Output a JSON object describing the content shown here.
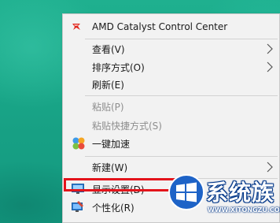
{
  "context_menu": {
    "items": [
      {
        "label": "AMD Catalyst Control Center",
        "icon": "amd-icon",
        "disabled": false,
        "submenu": false
      },
      {
        "label": "查看(V)",
        "icon": null,
        "disabled": false,
        "submenu": true
      },
      {
        "label": "排序方式(O)",
        "icon": null,
        "disabled": false,
        "submenu": true
      },
      {
        "label": "刷新(E)",
        "icon": null,
        "disabled": false,
        "submenu": false
      },
      {
        "label": "粘贴(P)",
        "icon": null,
        "disabled": true,
        "submenu": false
      },
      {
        "label": "粘贴快捷方式(S)",
        "icon": null,
        "disabled": true,
        "submenu": false
      },
      {
        "label": "一键加速",
        "icon": "speedup-icon",
        "disabled": false,
        "submenu": false
      },
      {
        "label": "新建(W)",
        "icon": null,
        "disabled": false,
        "submenu": true
      },
      {
        "label": "显示设置(D)",
        "icon": "display-settings-icon",
        "disabled": false,
        "submenu": false
      },
      {
        "label": "个性化(R)",
        "icon": "personalize-icon",
        "disabled": false,
        "submenu": false
      }
    ]
  },
  "highlight": {
    "target": "显示设置(D)",
    "color": "#e3141b"
  },
  "watermark": {
    "title": "系统族",
    "url": "WWW.XITONGZU.COM",
    "logo": "windows-logo-icon"
  },
  "colors": {
    "desktop": "#1aa889",
    "menu_background": "#f2f2f2",
    "disabled_text": "#8e8e8e",
    "highlight_border": "#e3141b"
  }
}
